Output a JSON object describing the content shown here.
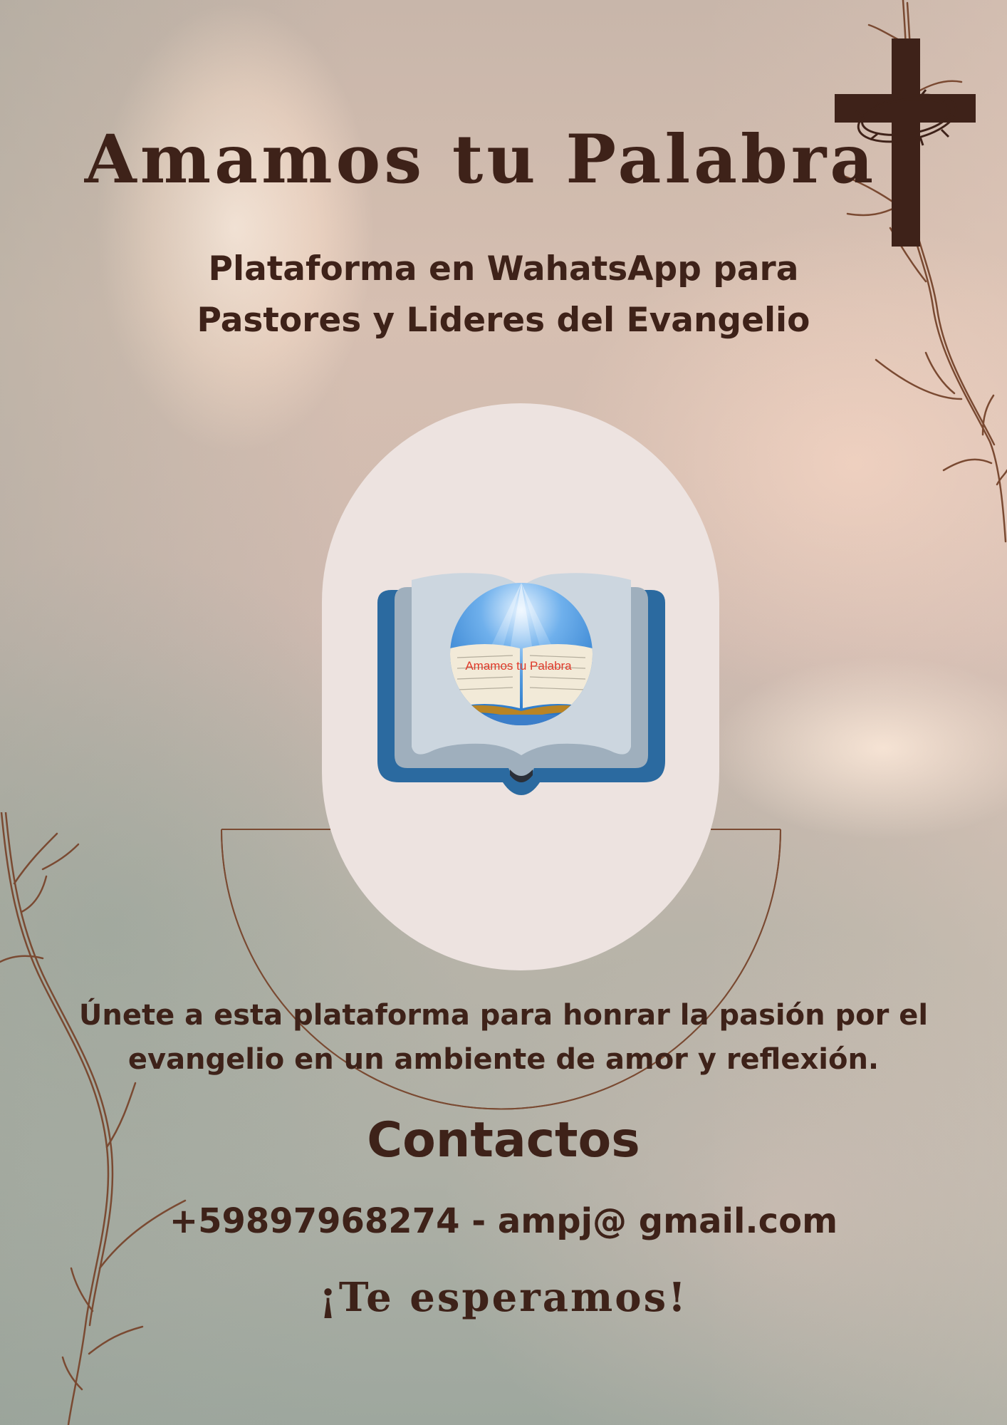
{
  "poster": {
    "title": "Amamos tu Palabra",
    "subtitle_lines": [
      "Plataforma en WahatsApp para",
      "Pastores y Lideres del Evangelio"
    ],
    "logo": {
      "caption": "Amamos tu Palabra",
      "icon": "open-bible-icon"
    },
    "description_lines": [
      "Únete a esta plataforma para honrar la pasión por el",
      "evangelio en un ambiente de amor y reflexión."
    ],
    "contacts_heading": "Contactos",
    "contact_line": "+59897968274 - ampj@ gmail.com",
    "closing": "¡Te esperamos!"
  },
  "decorations": {
    "cross": "cross-with-thorn-crown-icon",
    "branches": [
      "branch-right-icon",
      "branch-left-icon"
    ]
  },
  "colors": {
    "text": "#3e2219",
    "pill": "#ede3e0",
    "book_cover": "#2b6aa0",
    "caption": "#e03a2a"
  }
}
